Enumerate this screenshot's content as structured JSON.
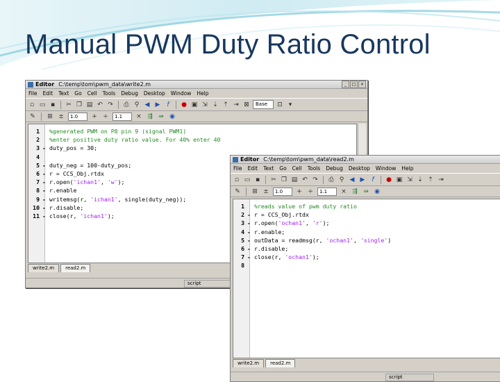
{
  "slide": {
    "title": "Manual PWM Duty Ratio Control"
  },
  "window1": {
    "app_label": "Editor",
    "path": "C:\\temp\\tom\\pwm_data\\write2.m",
    "menu": [
      "File",
      "Edit",
      "Text",
      "Go",
      "Cell",
      "Tools",
      "Debug",
      "Desktop",
      "Window",
      "Help"
    ],
    "cell_value_1": "1.0",
    "cell_value_2": "1.1",
    "stack_label": "Base",
    "lines": [
      {
        "n": "1",
        "dash": "",
        "code": [
          {
            "t": "%generated PWM on P8 pin 9 (signal PWM1)",
            "c": "cmt"
          }
        ]
      },
      {
        "n": "2",
        "dash": "",
        "code": [
          {
            "t": "%enter positive duty ratio value. For 40% enter 40",
            "c": "cmt"
          }
        ]
      },
      {
        "n": "3",
        "dash": "-",
        "code": [
          {
            "t": "duty_pos = 30;",
            "c": ""
          }
        ]
      },
      {
        "n": "4",
        "dash": "",
        "code": []
      },
      {
        "n": "5",
        "dash": "-",
        "code": [
          {
            "t": "duty_neg = 100-duty_pos;",
            "c": ""
          }
        ]
      },
      {
        "n": "6",
        "dash": "-",
        "code": [
          {
            "t": "r = CCS_Obj.rtdx",
            "c": ""
          }
        ]
      },
      {
        "n": "7",
        "dash": "-",
        "code": [
          {
            "t": "r.open(",
            "c": ""
          },
          {
            "t": "'ichan1'",
            "c": "str"
          },
          {
            "t": ", ",
            "c": ""
          },
          {
            "t": "'w'",
            "c": "str"
          },
          {
            "t": ");",
            "c": ""
          }
        ]
      },
      {
        "n": "8",
        "dash": "-",
        "code": [
          {
            "t": "r.enable",
            "c": ""
          }
        ]
      },
      {
        "n": "9",
        "dash": "-",
        "code": [
          {
            "t": "writemsg(r, ",
            "c": ""
          },
          {
            "t": "'ichan1'",
            "c": "str"
          },
          {
            "t": ", single(duty_neg));",
            "c": ""
          }
        ]
      },
      {
        "n": "10",
        "dash": "-",
        "code": [
          {
            "t": "r.disable;",
            "c": ""
          }
        ]
      },
      {
        "n": "11",
        "dash": "-",
        "code": [
          {
            "t": "close(r, ",
            "c": ""
          },
          {
            "t": "'ichan1'",
            "c": "str"
          },
          {
            "t": ");",
            "c": ""
          }
        ]
      }
    ],
    "tabs": [
      "write2.m",
      "read2.m"
    ],
    "status_script": "script"
  },
  "window2": {
    "app_label": "Editor",
    "path": "C:\\temp\\tom\\pwm_data\\read2.m",
    "menu": [
      "File",
      "Edit",
      "Text",
      "Go",
      "Cell",
      "Tools",
      "Debug",
      "Desktop",
      "Window",
      "Help"
    ],
    "cell_value_1": "1.0",
    "cell_value_2": "1.1",
    "lines": [
      {
        "n": "1",
        "dash": "",
        "code": [
          {
            "t": "%reads value of pwm duty ratio",
            "c": "cmt"
          }
        ]
      },
      {
        "n": "2",
        "dash": "-",
        "code": [
          {
            "t": "r = CCS_Obj.rtdx",
            "c": ""
          }
        ]
      },
      {
        "n": "3",
        "dash": "-",
        "code": [
          {
            "t": "r.open(",
            "c": ""
          },
          {
            "t": "'ochan1'",
            "c": "str"
          },
          {
            "t": ", ",
            "c": ""
          },
          {
            "t": "'r'",
            "c": "str"
          },
          {
            "t": ");",
            "c": ""
          }
        ]
      },
      {
        "n": "4",
        "dash": "-",
        "code": [
          {
            "t": "r.enable;",
            "c": ""
          }
        ]
      },
      {
        "n": "5",
        "dash": "-",
        "code": [
          {
            "t": "outData = readmsg(r, ",
            "c": ""
          },
          {
            "t": "'ochan1'",
            "c": "str"
          },
          {
            "t": ", ",
            "c": ""
          },
          {
            "t": "'single'",
            "c": "str"
          },
          {
            "t": ")",
            "c": ""
          }
        ]
      },
      {
        "n": "6",
        "dash": "-",
        "code": [
          {
            "t": "r.disable;",
            "c": ""
          }
        ]
      },
      {
        "n": "7",
        "dash": "-",
        "code": [
          {
            "t": "close(r, ",
            "c": ""
          },
          {
            "t": "'ochan1'",
            "c": "str"
          },
          {
            "t": ");",
            "c": ""
          }
        ]
      },
      {
        "n": "8",
        "dash": "",
        "code": []
      }
    ],
    "tabs": [
      "write2.m",
      "read2.m"
    ],
    "status_script": "script"
  }
}
